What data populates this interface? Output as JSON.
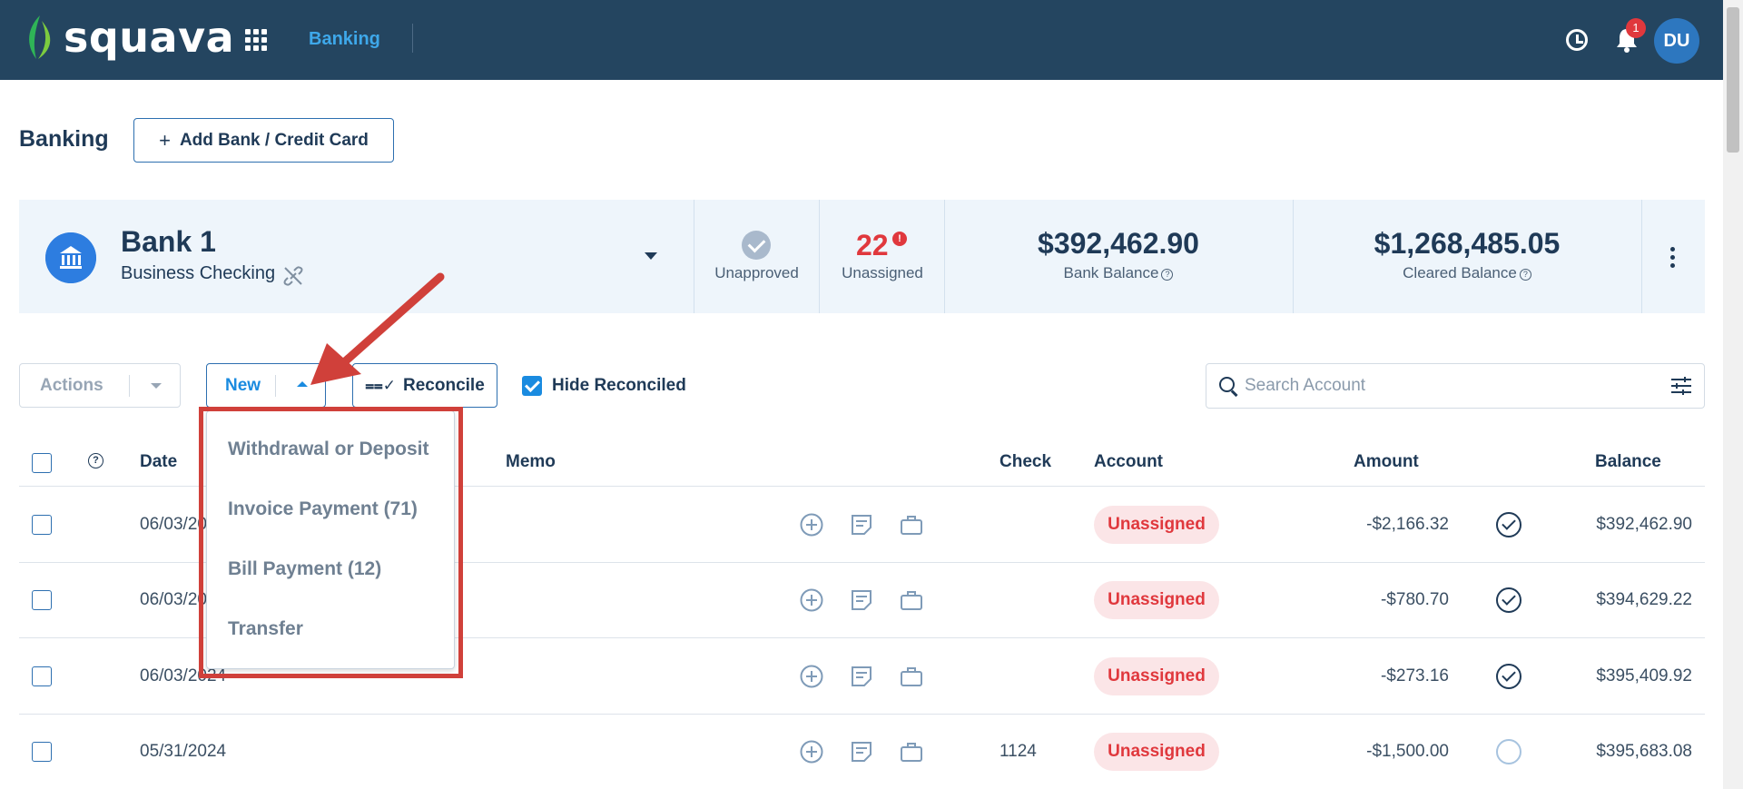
{
  "app": {
    "brand": "squava",
    "nav_active": "Banking",
    "notification_count": "1",
    "user_initials": "DU"
  },
  "page": {
    "title": "Banking",
    "add_bank_label": "Add Bank / Credit Card"
  },
  "account": {
    "name": "Bank 1",
    "type": "Business Checking",
    "unapproved_label": "Unapproved",
    "unassigned_count": "22",
    "unassigned_label": "Unassigned",
    "bank_balance": "$392,462.90",
    "bank_balance_label": "Bank Balance",
    "cleared_balance": "$1,268,485.05",
    "cleared_balance_label": "Cleared Balance"
  },
  "toolbar": {
    "actions_label": "Actions",
    "new_label": "New",
    "reconcile_label": "Reconcile",
    "hide_reconciled_label": "Hide Reconciled",
    "hide_reconciled_checked": true,
    "search_placeholder": "Search Account"
  },
  "new_menu": {
    "items": [
      "Withdrawal or Deposit",
      "Invoice Payment (71)",
      "Bill Payment (12)",
      "Transfer"
    ]
  },
  "table": {
    "columns": {
      "date": "Date",
      "memo": "Memo",
      "check": "Check",
      "account": "Account",
      "amount": "Amount",
      "balance": "Balance"
    },
    "rows": [
      {
        "date": "06/03/20",
        "check": "",
        "account": "Unassigned",
        "amount": "-$2,166.32",
        "status": "approved",
        "balance": "$392,462.90"
      },
      {
        "date": "06/03/20",
        "check": "",
        "account": "Unassigned",
        "amount": "-$780.70",
        "status": "approved",
        "balance": "$394,629.22"
      },
      {
        "date": "06/03/2024",
        "check": "",
        "account": "Unassigned",
        "amount": "-$273.16",
        "status": "approved",
        "balance": "$395,409.92"
      },
      {
        "date": "05/31/2024",
        "check": "1124",
        "account": "Unassigned",
        "amount": "-$1,500.00",
        "status": "pending",
        "balance": "$395,683.08"
      }
    ]
  },
  "colors": {
    "topbar": "#244560",
    "accent": "#1a8be0",
    "danger": "#e0383d",
    "annotation": "#d0403a"
  }
}
